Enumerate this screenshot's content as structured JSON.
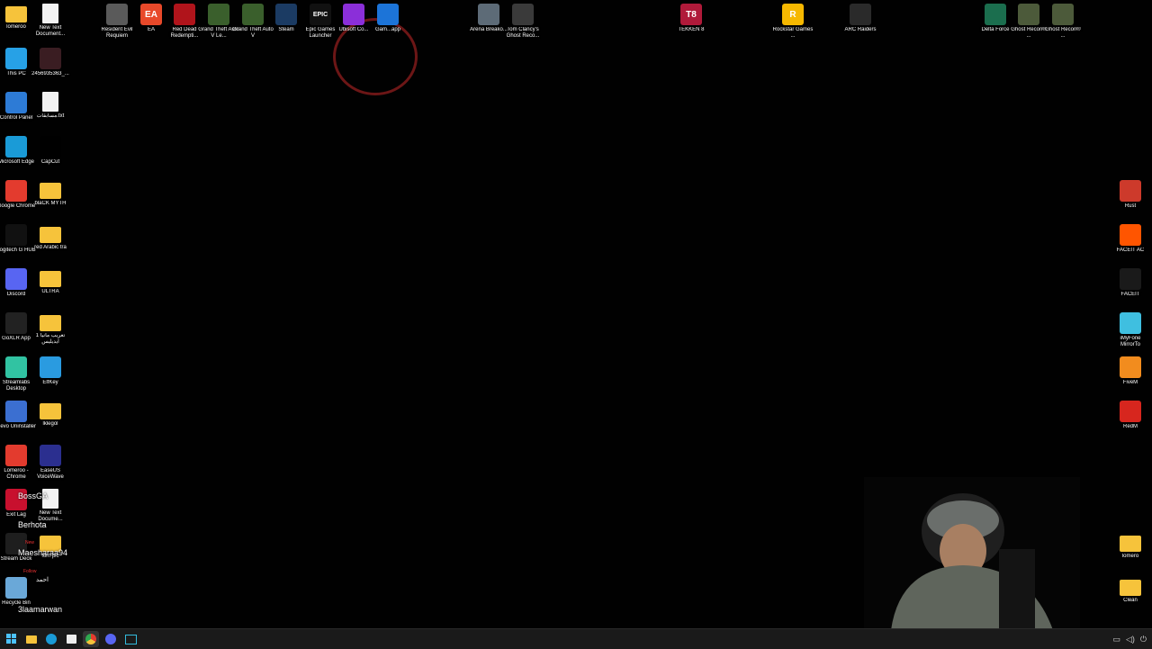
{
  "desktop": {
    "left_col1": [
      {
        "label": "lomeroo",
        "icon": "folder-icon",
        "kind": "folder"
      },
      {
        "label": "This PC",
        "icon": "monitor-icon",
        "color": "#27a1e6"
      },
      {
        "label": "Control Panel",
        "icon": "control-panel-icon",
        "color": "#2d7bd6"
      },
      {
        "label": "Microsoft Edge",
        "icon": "edge-icon",
        "color": "#1a9bd7"
      },
      {
        "label": "Google Chrome",
        "icon": "chrome-icon",
        "color": "#e33b2e"
      },
      {
        "label": "Logitech G HUB",
        "icon": "logitech-icon",
        "color": "#111111"
      },
      {
        "label": "Discord",
        "icon": "discord-icon",
        "color": "#5865f2"
      },
      {
        "label": "GoXLR App",
        "icon": "goxlr-icon",
        "color": "#222222"
      },
      {
        "label": "Streamlabs Desktop",
        "icon": "streamlabs-icon",
        "color": "#31c3a2"
      },
      {
        "label": "Revo Uninstaller",
        "icon": "revo-icon",
        "color": "#3b6fd1"
      },
      {
        "label": "Lomeroo - Chrome",
        "icon": "chrome-icon",
        "color": "#e33b2e"
      },
      {
        "label": "Exit Lag",
        "icon": "exitlag-icon",
        "color": "#c8102e"
      },
      {
        "label": "Stream Deck",
        "icon": "stream-deck-icon",
        "color": "#1e1e1e"
      },
      {
        "label": "Recycle Bin",
        "icon": "recycle-bin-icon",
        "color": "#6aa8d8"
      }
    ],
    "left_col2": [
      {
        "label": "New Text Document...",
        "icon": "text-document-icon",
        "kind": "doc"
      },
      {
        "label": "2456935363_...",
        "icon": "image-file-icon",
        "color": "#3a1d22"
      },
      {
        "label": "مسابقات.txt",
        "icon": "text-document-icon",
        "kind": "doc"
      },
      {
        "label": "CapCut",
        "icon": "capcut-icon",
        "color": "#000000"
      },
      {
        "label": "blaCK MYTH",
        "icon": "folder-icon",
        "kind": "folder"
      },
      {
        "label": "red Arabic tra",
        "icon": "folder-icon",
        "kind": "folder"
      },
      {
        "label": "ULTRA",
        "icon": "folder-icon",
        "kind": "folder"
      },
      {
        "label": "تعريب مانيا 1 ايديليس",
        "icon": "folder-icon",
        "kind": "folder"
      },
      {
        "label": "ElfKey",
        "icon": "elfkey-icon",
        "color": "#2a9be0"
      },
      {
        "label": "lklegol",
        "icon": "folder-icon",
        "kind": "folder"
      },
      {
        "label": "EaseUS VoiceWave",
        "icon": "easeus-icon",
        "color": "#2b2f8f"
      },
      {
        "label": "New Text Docume...",
        "icon": "text-document-icon",
        "kind": "doc"
      },
      {
        "label": "lom pic",
        "icon": "folder-icon",
        "kind": "folder"
      }
    ],
    "top_row": [
      {
        "label": "Resident Evil Requiem",
        "icon": "resident-evil-icon",
        "color": "#5a5a5a"
      },
      {
        "label": "EA",
        "icon": "ea-icon",
        "color": "#e8492a",
        "glyph": "EA"
      },
      {
        "label": "Red Dead Redempti...",
        "icon": "red-dead-icon",
        "color": "#b0141b"
      },
      {
        "label": "Grand Theft Auto V Le...",
        "icon": "gta-icon",
        "color": "#3a5f2c"
      },
      {
        "label": "Grand Theft Auto V",
        "icon": "gta-icon",
        "color": "#3a5f2c"
      },
      {
        "label": "Steam",
        "icon": "steam-icon",
        "color": "#1b3b63"
      },
      {
        "label": "Epic Games Launcher",
        "icon": "epic-games-icon",
        "color": "#111111",
        "glyph": "EPIC"
      },
      {
        "label": "Ubisoft Co...",
        "icon": "ubisoft-icon",
        "color": "#8b2fd9"
      },
      {
        "label": "Gam...app",
        "icon": "game-app-icon",
        "color": "#1c74d8"
      },
      {
        "label": "Arena Breako...",
        "icon": "arena-breakout-icon",
        "color": "#5d6b77"
      },
      {
        "label": "Tom Clancy's Ghost Reco...",
        "icon": "ghost-recon-icon",
        "color": "#3a3a3a"
      },
      {
        "label": "TEKKEN 8",
        "icon": "tekken-icon",
        "color": "#b01a3a",
        "glyph": "T8"
      },
      {
        "label": "Rockstar Games ...",
        "icon": "rockstar-icon",
        "color": "#f6b800",
        "glyph": "R"
      },
      {
        "label": "ARC Raiders",
        "icon": "arc-raiders-icon",
        "color": "#2a2a2a"
      },
      {
        "label": "Delta Force",
        "icon": "delta-force-icon",
        "color": "#1b6e4e"
      },
      {
        "label": "Ghost Recon® ...",
        "icon": "ghost-recon-icon",
        "color": "#4c5a3a"
      },
      {
        "label": "Ghost Recon® ...",
        "icon": "ghost-recon-icon",
        "color": "#4c5a3a"
      }
    ],
    "right_col": [
      {
        "label": "Rust",
        "icon": "rust-icon",
        "color": "#cd3a2b"
      },
      {
        "label": "FACEIT AC",
        "icon": "faceit-ac-icon",
        "color": "#ff5500"
      },
      {
        "label": "FACEIT",
        "icon": "faceit-icon",
        "color": "#1a1a1a"
      },
      {
        "label": "iMyFone MirrorTo",
        "icon": "imyfone-icon",
        "color": "#3fbfe0"
      },
      {
        "label": "FiveM",
        "icon": "fivem-icon",
        "color": "#f28c1e"
      },
      {
        "label": "RedM",
        "icon": "redm-icon",
        "color": "#d7261e"
      },
      {
        "label": "lomero",
        "icon": "folder-icon",
        "kind": "folder"
      },
      {
        "label": "Clean",
        "icon": "folder-icon",
        "kind": "folder"
      }
    ]
  },
  "overlay": {
    "names": [
      "BossGA",
      "Berhota",
      "Maesharaa94",
      "احمد",
      "3laamarwan"
    ],
    "follow_tags": [
      "New",
      "Follow"
    ]
  },
  "taskbar": {
    "items": [
      "windows-start-icon",
      "file-explorer-icon",
      "edge-icon",
      "store-icon",
      "chrome-icon",
      "discord-icon",
      "goxlr-icon"
    ],
    "tray": [
      "network-icon",
      "volume-icon",
      "power-icon"
    ]
  }
}
